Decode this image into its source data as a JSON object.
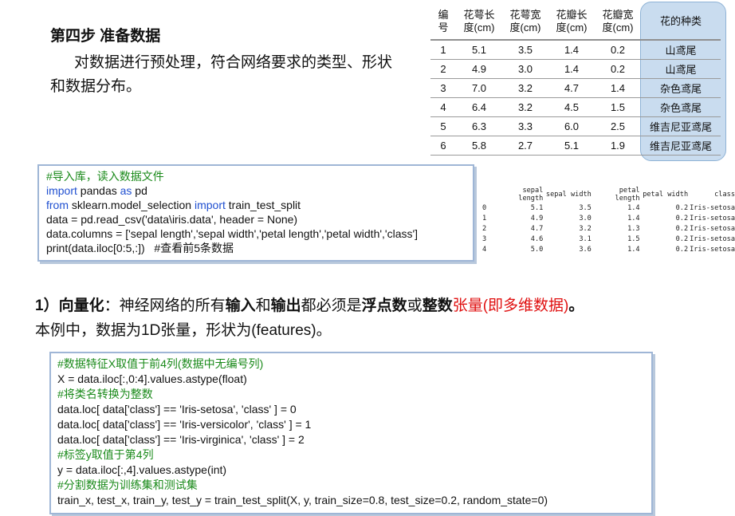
{
  "step": {
    "title": "第四步 准备数据",
    "desc": "对数据进行预处理，符合网络要求的类型、形状和数据分布。"
  },
  "iris_table": {
    "headers": [
      "编号",
      "花萼长度(cm)",
      "花萼宽度(cm)",
      "花瓣长度(cm)",
      "花瓣宽度(cm)",
      "花的种类"
    ],
    "header_lines": [
      [
        "编",
        "号"
      ],
      [
        "花萼长",
        "度(cm)"
      ],
      [
        "花萼宽",
        "度(cm)"
      ],
      [
        "花瓣长",
        "度(cm)"
      ],
      [
        "花瓣宽",
        "度(cm)"
      ],
      [
        "花的种类"
      ]
    ],
    "rows": [
      [
        "1",
        "5.1",
        "3.5",
        "1.4",
        "0.2",
        "山鸢尾"
      ],
      [
        "2",
        "4.9",
        "3.0",
        "1.4",
        "0.2",
        "山鸢尾"
      ],
      [
        "3",
        "7.0",
        "3.2",
        "4.7",
        "1.4",
        "杂色鸢尾"
      ],
      [
        "4",
        "6.4",
        "3.2",
        "4.5",
        "1.5",
        "杂色鸢尾"
      ],
      [
        "5",
        "6.3",
        "3.3",
        "6.0",
        "2.5",
        "维吉尼亚鸢尾"
      ],
      [
        "6",
        "5.8",
        "2.7",
        "5.1",
        "1.9",
        "维吉尼亚鸢尾"
      ]
    ]
  },
  "code1": {
    "lines": [
      [
        {
          "t": "#导入库，读入数据文件",
          "c": "cm"
        }
      ],
      [
        {
          "t": "import",
          "c": "kw"
        },
        {
          "t": " pandas ",
          "c": ""
        },
        {
          "t": "as",
          "c": "kw"
        },
        {
          "t": " pd",
          "c": ""
        }
      ],
      [
        {
          "t": "from",
          "c": "kw"
        },
        {
          "t": " sklearn.model_selection ",
          "c": ""
        },
        {
          "t": "import",
          "c": "kw"
        },
        {
          "t": " train_test_split",
          "c": ""
        }
      ],
      [
        {
          "t": "data = pd.read_csv('data\\iris.data', header = None)",
          "c": ""
        }
      ],
      [
        {
          "t": "data.columns = ['sepal length','sepal width','petal length','petal width','class']",
          "c": ""
        }
      ],
      [
        {
          "t": "print(data.iloc[0:5,:])   ",
          "c": ""
        },
        {
          "t": "#查看前5条数据",
          "c": ""
        }
      ]
    ]
  },
  "dataframe": {
    "columns": [
      "",
      "sepal length",
      "sepal width",
      "petal length",
      "petal width",
      "class"
    ],
    "rows": [
      [
        "0",
        "5.1",
        "3.5",
        "1.4",
        "0.2",
        "Iris-setosa"
      ],
      [
        "1",
        "4.9",
        "3.0",
        "1.4",
        "0.2",
        "Iris-setosa"
      ],
      [
        "2",
        "4.7",
        "3.2",
        "1.3",
        "0.2",
        "Iris-setosa"
      ],
      [
        "3",
        "4.6",
        "3.1",
        "1.5",
        "0.2",
        "Iris-setosa"
      ],
      [
        "4",
        "5.0",
        "3.6",
        "1.4",
        "0.2",
        "Iris-setosa"
      ]
    ]
  },
  "vectorize": {
    "segments": [
      {
        "t": "1）向量化",
        "s": "b"
      },
      {
        "t": "：神经网络的所有",
        "s": ""
      },
      {
        "t": "输入",
        "s": "b"
      },
      {
        "t": "和",
        "s": ""
      },
      {
        "t": "输出",
        "s": "b"
      },
      {
        "t": "都必须是",
        "s": ""
      },
      {
        "t": "浮点数",
        "s": "b"
      },
      {
        "t": "或",
        "s": ""
      },
      {
        "t": "整数",
        "s": "b"
      },
      {
        "t": "张量(即多维数据)",
        "s": "red"
      },
      {
        "t": "。",
        "s": "b"
      }
    ],
    "line2": "本例中，数据为1D张量，形状为(features)。"
  },
  "code2": {
    "lines": [
      [
        {
          "t": "#数据特征X取值于前4列(数据中无编号列)",
          "c": "cm"
        }
      ],
      [
        {
          "t": "X = data.iloc[:,0:4].values.astype(float)",
          "c": ""
        }
      ],
      [
        {
          "t": "#将类名转换为整数",
          "c": "cm"
        }
      ],
      [
        {
          "t": "data.loc[ data['class'] == 'Iris-setosa', 'class' ] = 0",
          "c": ""
        }
      ],
      [
        {
          "t": "data.loc[ data['class'] == 'Iris-versicolor', 'class' ] = 1",
          "c": ""
        }
      ],
      [
        {
          "t": "data.loc[ data['class'] == 'Iris-virginica', 'class' ] = 2",
          "c": ""
        }
      ],
      [
        {
          "t": "#标签y取值于第4列",
          "c": "cm"
        }
      ],
      [
        {
          "t": "y = data.iloc[:,4].values.astype(int)",
          "c": ""
        }
      ],
      [
        {
          "t": "#分割数据为训练集和测试集",
          "c": "cm"
        }
      ],
      [
        {
          "t": "train_x, test_x, train_y, test_y = train_test_split(X, y, train_size=0.8, test_size=0.2, random_state=0)",
          "c": ""
        }
      ]
    ]
  },
  "colors": {
    "comment": "#1a8a1a",
    "keyword": "#1f4fd0",
    "highlight": "#e01010",
    "species_band": "#c9dcef"
  }
}
